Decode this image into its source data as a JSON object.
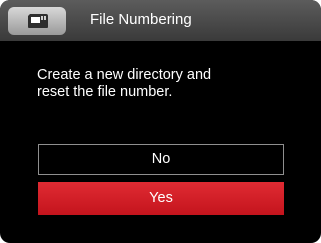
{
  "header": {
    "icon": "sd-card-icon",
    "title": "File Numbering"
  },
  "message": "Create a new directory and\nreset the file number.",
  "options": [
    {
      "label": "No",
      "selected": false
    },
    {
      "label": "Yes",
      "selected": true
    }
  ],
  "colors": {
    "selected_option": "#d21f27",
    "background": "#000000",
    "header": "#4a4a4a"
  }
}
